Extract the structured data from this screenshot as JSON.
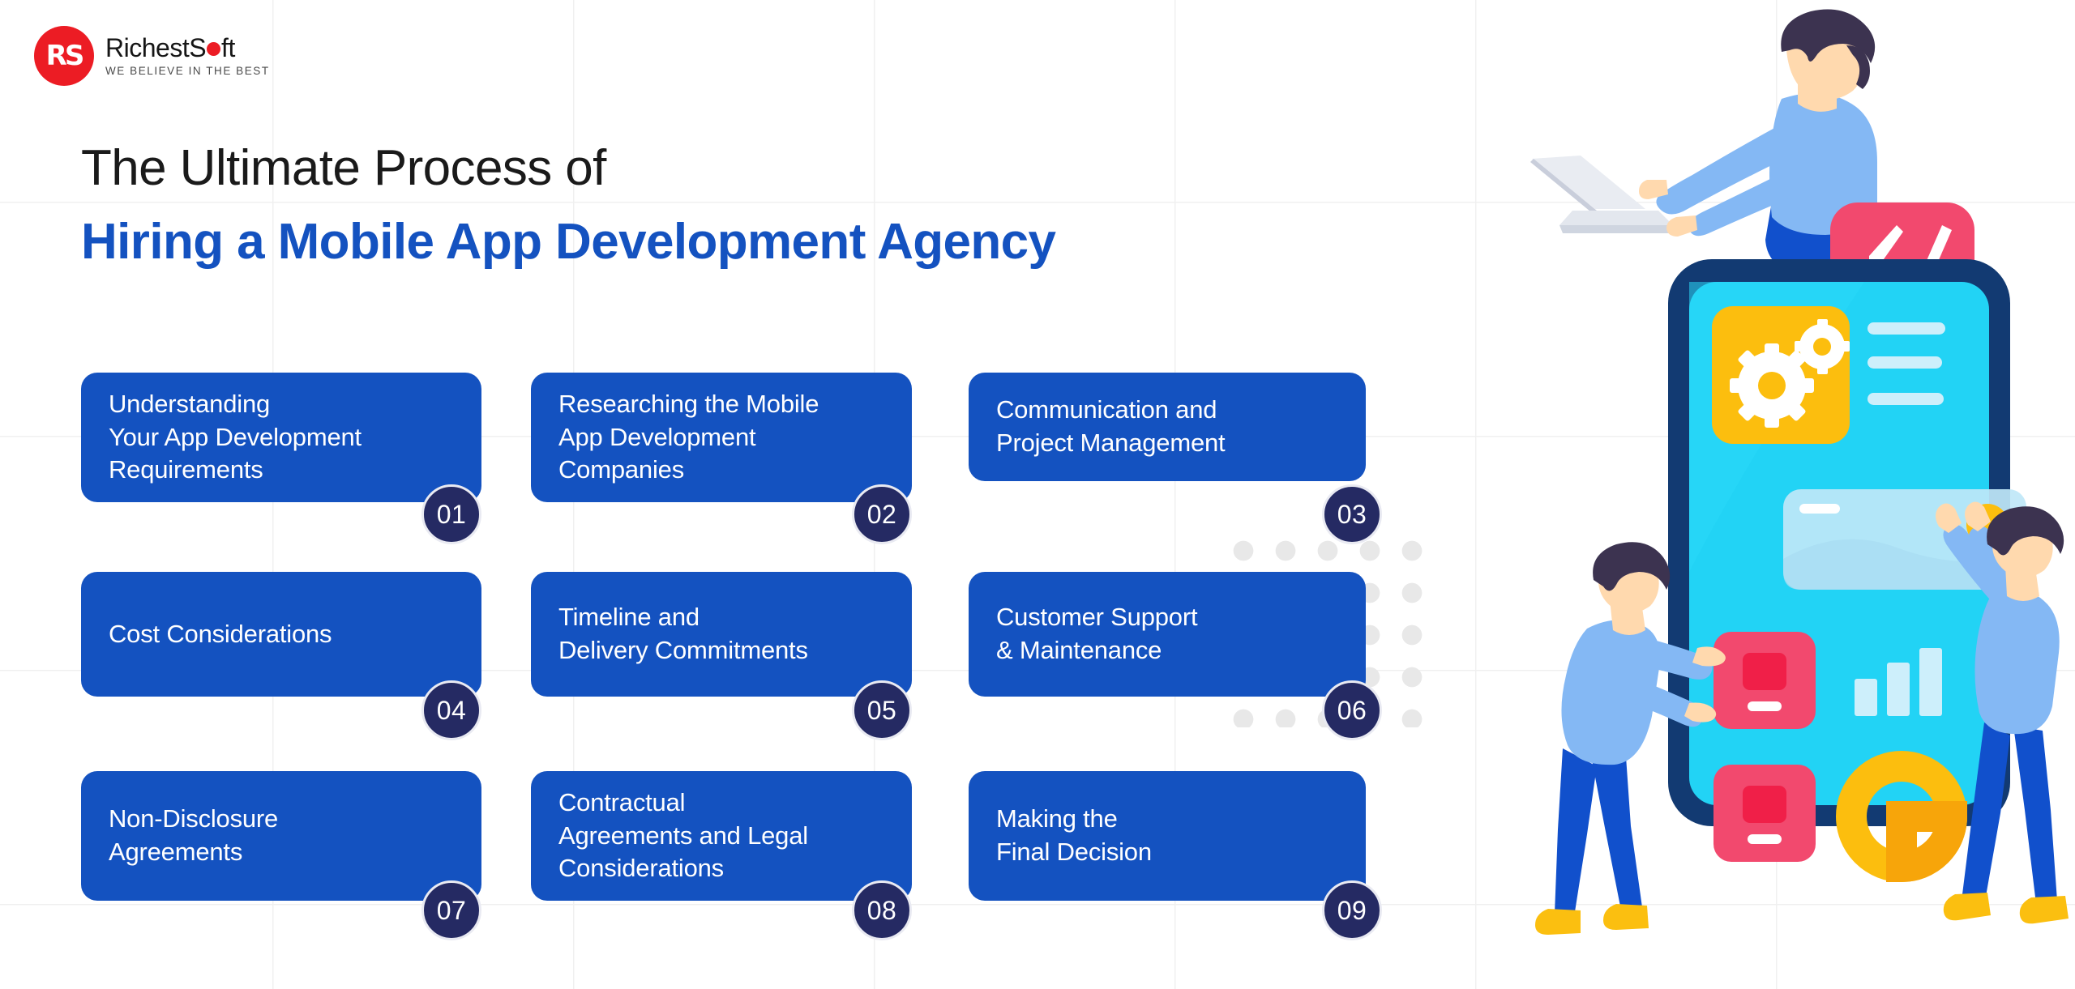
{
  "brand": {
    "name_part1": "RichestS",
    "name_part2": "ft",
    "tagline": "WE BELIEVE IN THE BEST",
    "mark_initials": "RS",
    "mark_color": "#ec1c24"
  },
  "heading": {
    "line1": "The Ultimate Process of",
    "line2": "Hiring a Mobile App Development Agency",
    "line1_color": "#1a1a1a",
    "line2_color": "#1452c0"
  },
  "theme": {
    "card_bg": "#1452c0",
    "badge_bg": "#252a63",
    "badge_ring": "#e9eaf2",
    "dot_color": "#e8e8e8",
    "accent_pink": "#f2496e",
    "accent_yellow": "#fcbe0e",
    "accent_cyan": "#22d3f5",
    "phone_frame": "#123a72",
    "skin": "#ffd9ae",
    "hair": "#3c3350",
    "shirt": "#84b8f4",
    "pants": "#1150cc",
    "shoes": "#fbbf10"
  },
  "cards": [
    {
      "number": "01",
      "text": "Understanding\nYour App Development\nRequirements"
    },
    {
      "number": "02",
      "text": "Researching the Mobile\nApp Development\nCompanies"
    },
    {
      "number": "03",
      "text": "Communication and\nProject Management"
    },
    {
      "number": "04",
      "text": "Cost Considerations"
    },
    {
      "number": "05",
      "text": "Timeline and\nDelivery Commitments"
    },
    {
      "number": "06",
      "text": "Customer Support\n& Maintenance"
    },
    {
      "number": "07",
      "text": "Non-Disclosure\nAgreements"
    },
    {
      "number": "08",
      "text": "Contractual\nAgreements and Legal\nConsiderations"
    },
    {
      "number": "09",
      "text": "Making the\nFinal Decision"
    }
  ],
  "illustration": {
    "code_badge_label": "</",
    "phone_app_icon": "gears-icon",
    "phone_chart_icon": "bar-chart-icon",
    "phone_donut_icon": "donut-chart-icon"
  }
}
